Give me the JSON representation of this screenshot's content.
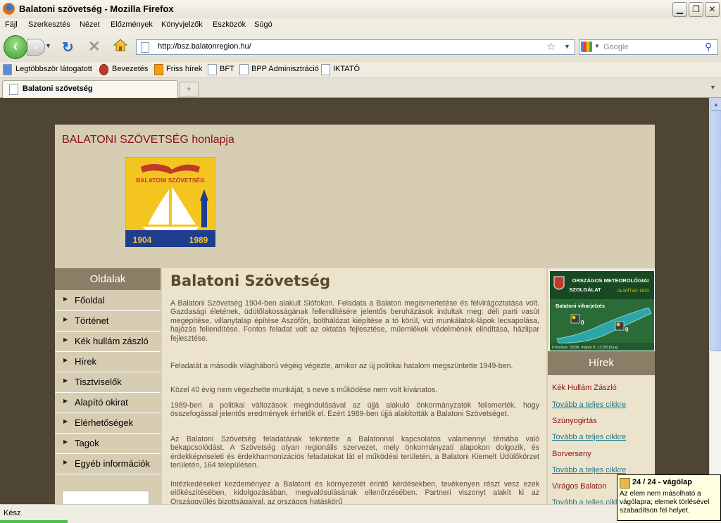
{
  "window": {
    "title": "Balatoni szövetség - Mozilla Firefox"
  },
  "menu": [
    "Fájl",
    "Szerkesztés",
    "Nézet",
    "Előzmények",
    "Könyvjelzők",
    "Eszközök",
    "Súgó"
  ],
  "nav": {
    "url": "http://bsz.balatonregion.hu/",
    "search_placeholder": "Google"
  },
  "bookmarks": [
    "Legtöbbször látogatott",
    "Bevezetés",
    "Friss hírek",
    "BFT",
    "BPP Adminisztráció",
    "IKTATÓ"
  ],
  "tabs": [
    {
      "label": "Balatoni szövetség"
    }
  ],
  "site": {
    "title": "BALATONI SZÖVETSÉG honlapja",
    "logo": {
      "text": "BALATONI SZÖVETSÉG",
      "year_left": "1904",
      "year_right": "1989"
    },
    "sidebar": {
      "header": "Oldalak",
      "items": [
        "Főoldal",
        "Történet",
        "Kék hullám zászló",
        "Hírek",
        "Tisztviselők",
        "Alapító okirat",
        "Elérhetőségek",
        "Tagok",
        "Egyéb információk"
      ]
    },
    "main": {
      "heading": "Balatoni Szövetség",
      "paragraphs": [
        "A Balatoni Szövetség 1904-ben alakult Siófokon. Feladata a Balaton megismertetése és felvirágoztatása volt. Gazdasági életének, üdülőlakosságának fellendítésére jelentős beruházások indultak meg: déli parti vasút megépítése, villanytalap építése Aszófőn, bolthálózat kiépítése a tó körül, vizi munkálatok-lápok lecsapolása, hajózás fellendítése. Fontos feladat volt az oktatás fejlesztése, műemlékek védelmének elindítása, háziipar fejlesztése.",
        "Feladatát a második világháború végéig végezte, amikor az új politikai hatalom megszüntette 1949-ben.",
        "Közel 40 évig nem végezhette munkáját, s neve s működése nem volt kívánatos.",
        "1989-ben a politikai változások megindulásával az újjá alakuló önkormányzatok felismerték, hogy összefogással jelentős eredmények érhetők el. Ezért 1989-ben újjá alakították a Balatoni Szövetséget.",
        "Az Balatoni Szövetség feladatának tekintette a Balatonnal kapcsolatos valamennyi témába való bekapcsolódást. A Szövetség olyan regionális szervezet, mely önkormányzati alapokon dolgozik, és érdekképviseleti és érdekharmonizációs feladatokat lát el működési területén, a Balatoni Kiemelt Üdülőkörzet területén, 164 településen.",
        "Intézkedéseket kezdeményez a Balatont és környezetét érintő kérdésekben, tevékenyen részt vesz ezek előkészítésében, kidolgozásában, megvalósulásának ellenőrzésében. Partneri viszonyt alakít ki az Országgyűlés bizottságaival, az országos hatáskörű"
      ]
    },
    "weather": {
      "line1": "ORSZÁGOS METEOROLÓGIAI",
      "line2": "SZOLGÁLAT",
      "since": "ALAPÍTVA: 1870",
      "subtitle": "Balatoni viharjelzés",
      "marker_values": [
        "0",
        "0"
      ],
      "updated": "Frissítve: 2009. május 9. 11:28 [rGa]"
    },
    "news": {
      "header": "Hírek",
      "items": [
        {
          "title": "Kék Hullám Zászló",
          "link": "Tovább a teljes cikkre"
        },
        {
          "title": "Szúnyogirtás",
          "link": "Tovább a teljes cikkre"
        },
        {
          "title": "Borverseny",
          "link": "Tovább a teljes cikkre"
        },
        {
          "title": "Virágos Balaton",
          "link": "Tovább a teljes cikkre"
        }
      ]
    }
  },
  "status": {
    "text": "Kész"
  },
  "clipboard": {
    "title": "24 / 24 - vágólap",
    "body": "Az elem nem másolható a vágólapra; elemek törlésével szabadítson fel helyet."
  }
}
